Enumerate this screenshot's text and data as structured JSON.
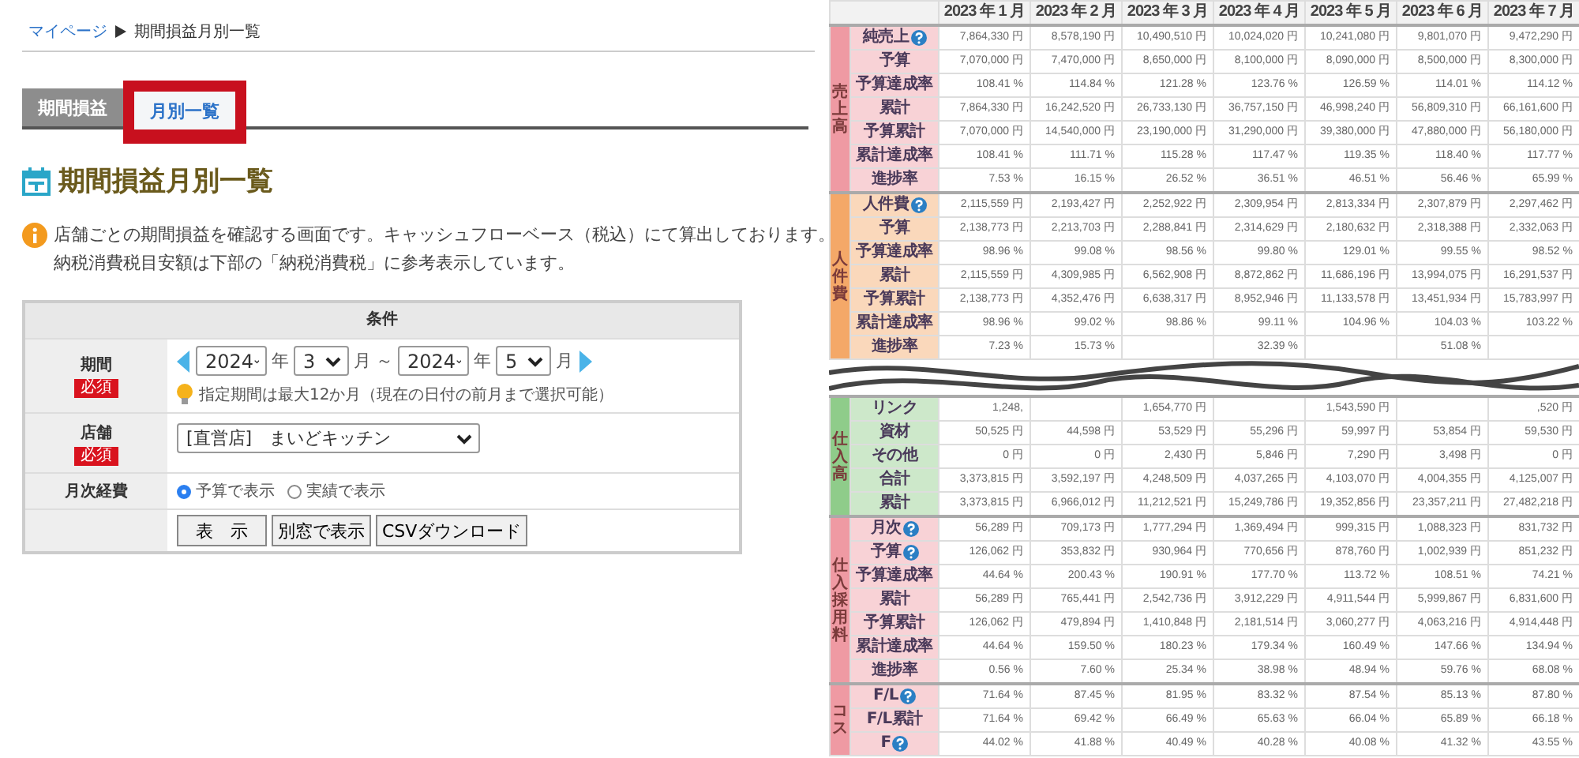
{
  "breadcrumb": [
    {
      "label": "マイページ",
      "kind": "link"
    },
    {
      "label": "期間損益月別一覧",
      "kind": "current"
    }
  ],
  "tabs": [
    {
      "label": "期間損益",
      "selected": false,
      "highlighted": false
    },
    {
      "label": "月別一覧",
      "selected": true,
      "highlighted": true
    }
  ],
  "page_title": "期間損益月別一覧",
  "notice_lines": [
    "店舗ごとの期間損益を確認する画面です。キャッシュフローベース（税込）にて算出しております。",
    "納税消費税目安額は下部の「納税消費税」に参考表示しています。"
  ],
  "conditions": {
    "title": "条件",
    "period": {
      "label": "期間",
      "badge": "必須",
      "from": {
        "year": "2024",
        "year_unit": "年",
        "month": "3",
        "month_unit": "月"
      },
      "separator": "～",
      "to": {
        "year": "2024",
        "year_unit": "年",
        "month": "5",
        "month_unit": "月"
      },
      "hint": "指定期間は最大12か月（現在の日付の前月まで選択可能）"
    },
    "store": {
      "label": "店舗",
      "badge": "必須",
      "value": "[直営店]　まいどキッチン"
    },
    "monthly_expense": {
      "label": "月次経費",
      "options": [
        {
          "label": "予算で表示",
          "selected": true
        },
        {
          "label": "実績で表示",
          "selected": false
        }
      ]
    },
    "buttons": [
      "表　示",
      "別窓で表示",
      "CSVダウンロード"
    ]
  },
  "report_table": {
    "columns": [
      "2023 年 1 月",
      "2023 年 2 月",
      "2023 年 3 月",
      "2023 年 4 月",
      "2023 年 5 月",
      "2023 年 6 月",
      "2023 年 7 月"
    ],
    "segments": [
      {
        "groups": [
          {
            "label": "売上高",
            "color": "#ef9aa3",
            "rows": [
              {
                "label": "純売上",
                "help": true,
                "cells": [
                  "7,864,330 円",
                  "8,578,190 円",
                  "10,490,510 円",
                  "10,024,020 円",
                  "10,241,080 円",
                  "9,801,070 円",
                  "9,472,290 円"
                ]
              },
              {
                "label": "予算",
                "help": false,
                "cells": [
                  "7,070,000 円",
                  "7,470,000 円",
                  "8,650,000 円",
                  "8,100,000 円",
                  "8,090,000 円",
                  "8,500,000 円",
                  "8,300,000 円"
                ]
              },
              {
                "label": "予算達成率",
                "help": false,
                "cells": [
                  "108.41 %",
                  "114.84 %",
                  "121.28 %",
                  "123.76 %",
                  "126.59 %",
                  "114.01 %",
                  "114.12 %"
                ]
              },
              {
                "label": "累計",
                "help": false,
                "cells": [
                  "7,864,330 円",
                  "16,242,520 円",
                  "26,733,130 円",
                  "36,757,150 円",
                  "46,998,240 円",
                  "56,809,310 円",
                  "66,161,600 円"
                ]
              },
              {
                "label": "予算累計",
                "help": false,
                "cells": [
                  "7,070,000 円",
                  "14,540,000 円",
                  "23,190,000 円",
                  "31,290,000 円",
                  "39,380,000 円",
                  "47,880,000 円",
                  "56,180,000 円"
                ]
              },
              {
                "label": "累計達成率",
                "help": false,
                "cells": [
                  "108.41 %",
                  "111.71 %",
                  "115.28 %",
                  "117.47 %",
                  "119.35 %",
                  "118.40 %",
                  "117.77 %"
                ]
              },
              {
                "label": "進捗率",
                "help": false,
                "cells": [
                  "7.53 %",
                  "16.15 %",
                  "26.52 %",
                  "36.51 %",
                  "46.51 %",
                  "56.46 %",
                  "65.99 %"
                ]
              }
            ]
          },
          {
            "label": "人件費",
            "color": "#f4a868",
            "rows": [
              {
                "label": "人件費",
                "help": true,
                "cells": [
                  "2,115,559 円",
                  "2,193,427 円",
                  "2,252,922 円",
                  "2,309,954 円",
                  "2,813,334 円",
                  "2,307,879 円",
                  "2,297,462 円"
                ]
              },
              {
                "label": "予算",
                "help": false,
                "cells": [
                  "2,138,773 円",
                  "2,213,703 円",
                  "2,288,841 円",
                  "2,314,629 円",
                  "2,180,632 円",
                  "2,318,388 円",
                  "2,332,063 円"
                ]
              },
              {
                "label": "予算達成率",
                "help": false,
                "cells": [
                  "98.96 %",
                  "99.08 %",
                  "98.56 %",
                  "99.80 %",
                  "129.01 %",
                  "99.55 %",
                  "98.52 %"
                ]
              },
              {
                "label": "累計",
                "help": false,
                "cells": [
                  "2,115,559 円",
                  "4,309,985 円",
                  "6,562,908 円",
                  "8,872,862 円",
                  "11,686,196 円",
                  "13,994,075 円",
                  "16,291,537 円"
                ]
              },
              {
                "label": "予算累計",
                "help": false,
                "cells": [
                  "2,138,773 円",
                  "4,352,476 円",
                  "6,638,317 円",
                  "8,952,946 円",
                  "11,133,578 円",
                  "13,451,934 円",
                  "15,783,997 円"
                ]
              },
              {
                "label": "累計達成率",
                "help": false,
                "cells": [
                  "98.96 %",
                  "99.02 %",
                  "98.86 %",
                  "99.11 %",
                  "104.96 %",
                  "104.03 %",
                  "103.22 %"
                ]
              },
              {
                "label": "進捗率",
                "help": false,
                "cells": [
                  "7.23 %",
                  "15.73 %",
                  null,
                  "32.39 %",
                  null,
                  "51.08 %",
                  null
                ]
              }
            ]
          }
        ]
      },
      {
        "groups": [
          {
            "label": "仕入高",
            "color": "#8fcc8a",
            "rows": [
              {
                "label": "リンク",
                "help": false,
                "cells": [
                  "1,248,",
                  null,
                  "1,654,770 円",
                  null,
                  "1,543,590 円",
                  null,
                  ",520 円"
                ]
              },
              {
                "label": "資材",
                "help": false,
                "cells": [
                  "50,525 円",
                  "44,598 円",
                  "53,529 円",
                  "55,296 円",
                  "59,997 円",
                  "53,854 円",
                  "59,530 円"
                ]
              },
              {
                "label": "その他",
                "help": false,
                "cells": [
                  "0 円",
                  "0 円",
                  "2,430 円",
                  "5,846 円",
                  "7,290 円",
                  "3,498 円",
                  "0 円"
                ]
              },
              {
                "label": "合計",
                "help": false,
                "cells": [
                  "3,373,815 円",
                  "3,592,197 円",
                  "4,248,509 円",
                  "4,037,265 円",
                  "4,103,070 円",
                  "4,004,355 円",
                  "4,125,007 円"
                ]
              },
              {
                "label": "累計",
                "help": false,
                "cells": [
                  "3,373,815 円",
                  "6,966,012 円",
                  "11,212,521 円",
                  "15,249,786 円",
                  "19,352,856 円",
                  "23,357,211 円",
                  "27,482,218 円"
                ]
              }
            ]
          },
          {
            "label": "仕入採用料",
            "color": "#ef9aa3",
            "rows": [
              {
                "label": "月次",
                "help": true,
                "cells": [
                  "56,289 円",
                  "709,173 円",
                  "1,777,294 円",
                  "1,369,494 円",
                  "999,315 円",
                  "1,088,323 円",
                  "831,732 円"
                ]
              },
              {
                "label": "予算",
                "help": true,
                "cells": [
                  "126,062 円",
                  "353,832 円",
                  "930,964 円",
                  "770,656 円",
                  "878,760 円",
                  "1,002,939 円",
                  "851,232 円"
                ]
              },
              {
                "label": "予算達成率",
                "help": false,
                "cells": [
                  "44.64 %",
                  "200.43 %",
                  "190.91 %",
                  "177.70 %",
                  "113.72 %",
                  "108.51 %",
                  "74.21 %"
                ]
              },
              {
                "label": "累計",
                "help": false,
                "cells": [
                  "56,289 円",
                  "765,441 円",
                  "2,542,736 円",
                  "3,912,229 円",
                  "4,911,544 円",
                  "5,999,867 円",
                  "6,831,600 円"
                ]
              },
              {
                "label": "予算累計",
                "help": false,
                "cells": [
                  "126,062 円",
                  "479,894 円",
                  "1,410,848 円",
                  "2,181,514 円",
                  "3,060,277 円",
                  "4,063,216 円",
                  "4,914,448 円"
                ]
              },
              {
                "label": "累計達成率",
                "help": false,
                "cells": [
                  "44.64 %",
                  "159.50 %",
                  "180.23 %",
                  "179.34 %",
                  "160.49 %",
                  "147.66 %",
                  "134.94 %"
                ]
              },
              {
                "label": "進捗率",
                "help": false,
                "cells": [
                  "0.56 %",
                  "7.60 %",
                  "25.34 %",
                  "38.98 %",
                  "48.94 %",
                  "59.76 %",
                  "68.08 %"
                ]
              }
            ]
          },
          {
            "label": "コス",
            "color": "#ef9aa3",
            "rows": [
              {
                "label": "F/L",
                "help": true,
                "cells": [
                  "71.64 %",
                  "87.45 %",
                  "81.95 %",
                  "83.32 %",
                  "87.54 %",
                  "85.13 %",
                  "87.80 %"
                ]
              },
              {
                "label": "F/L累計",
                "help": false,
                "cells": [
                  "71.64 %",
                  "69.42 %",
                  "66.49 %",
                  "65.63 %",
                  "66.04 %",
                  "65.89 %",
                  "66.18 %"
                ]
              },
              {
                "label": "F",
                "help": true,
                "cells": [
                  "44.02 %",
                  "41.88 %",
                  "40.49 %",
                  "40.28 %",
                  "40.08 %",
                  "41.32 %",
                  "43.55 %"
                ]
              }
            ]
          }
        ]
      }
    ]
  }
}
